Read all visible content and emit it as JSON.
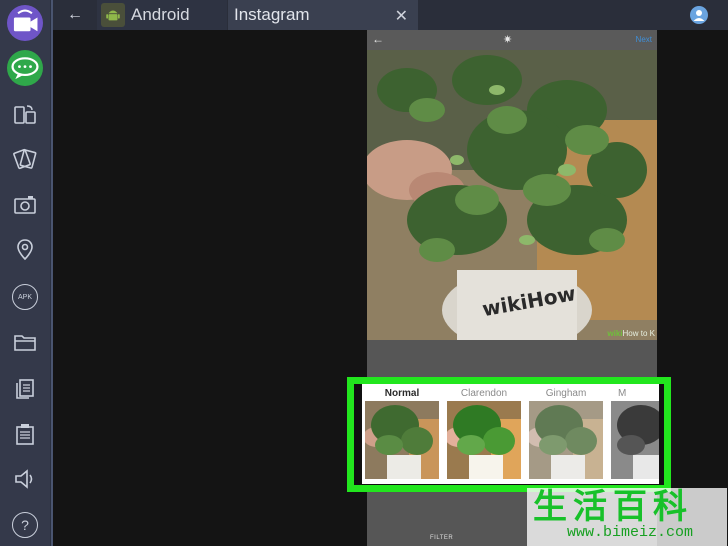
{
  "tabs": [
    {
      "label": "Android",
      "icon": "android-icon"
    },
    {
      "label": "Instagram",
      "icon": "close-icon"
    }
  ],
  "phone": {
    "top_bar": {
      "next_label": "Next"
    },
    "photo_watermark": {
      "brand": "wiki",
      "rest": "How to K"
    },
    "filter_tab_label": "FILTER"
  },
  "filters": [
    {
      "name": "Normal",
      "selected": true
    },
    {
      "name": "Clarendon",
      "selected": false
    },
    {
      "name": "Gingham",
      "selected": false
    },
    {
      "name": "M",
      "selected": false
    }
  ],
  "sidebar_icons": [
    "video-icon",
    "chat-icon",
    "rotate-screen-icon",
    "shake-icon",
    "screenshot-icon",
    "location-icon",
    "apk-icon",
    "folder-icon",
    "copy-icon",
    "paste-icon",
    "volume-icon",
    "help-icon"
  ],
  "sidebar_apk_label": "APK",
  "sidebar_help_label": "?",
  "watermark": {
    "text": "生活百科",
    "url": "www.bimeiz.com"
  },
  "colors": {
    "highlight": "#22e61e",
    "next": "#3f8fd8",
    "sidebar": "#34394a"
  }
}
